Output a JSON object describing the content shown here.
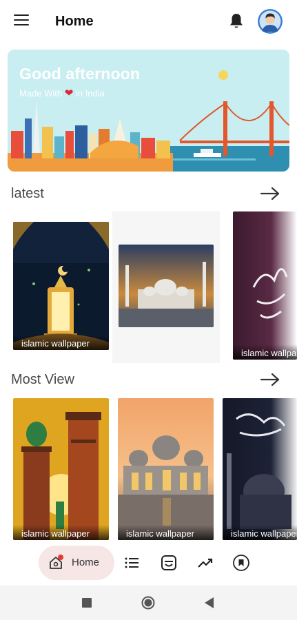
{
  "app_bar": {
    "title": "Home",
    "icons": [
      "menu-icon",
      "bell-icon",
      "avatar"
    ]
  },
  "banner": {
    "greeting": "Good afternoon",
    "tagline_before": "Made With",
    "tagline_heart": "❤",
    "tagline_after": "in India"
  },
  "sections": {
    "latest": {
      "title": "latest",
      "items": [
        {
          "label": "islamic wallpaper"
        },
        {
          "label": ""
        },
        {
          "label": "islamic wallpaper"
        }
      ]
    },
    "most_view": {
      "title": "Most View",
      "items": [
        {
          "label": "islamic wallpaper"
        },
        {
          "label": "islamic wallpaper"
        },
        {
          "label": "islamic wallpaper"
        }
      ]
    }
  },
  "bottom_nav": {
    "home_label": "Home",
    "items": [
      "home-icon",
      "list-icon",
      "collections-icon",
      "trending-icon",
      "bookmark-icon"
    ]
  },
  "colors": {
    "accent": "#e53935",
    "home_pill": "#f6e6e6",
    "banner_bg": "#c8eef1"
  }
}
